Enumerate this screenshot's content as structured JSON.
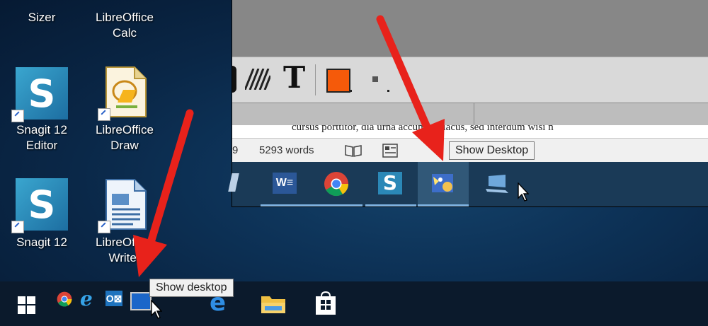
{
  "desktop": {
    "icons": [
      {
        "label": "Sizer"
      },
      {
        "label": "LibreOffice Calc"
      },
      {
        "label": "Snagit 12 Editor"
      },
      {
        "label": "LibreOffice Draw"
      },
      {
        "label": "Snagit 12"
      },
      {
        "label": "LibreOffice Writer"
      }
    ]
  },
  "inset": {
    "doc_text": "cursus porttitor, dia urna accumsan lacus, sed interdum wisi n",
    "status": {
      "page_partial": "9",
      "word_count": "5293 words"
    },
    "tooltip": "Show Desktop"
  },
  "taskbar": {
    "tooltip": "Show desktop"
  },
  "colors": {
    "arrow": "#e8221b",
    "accent": "#7fb2e0",
    "desktop": "#0d3257"
  }
}
